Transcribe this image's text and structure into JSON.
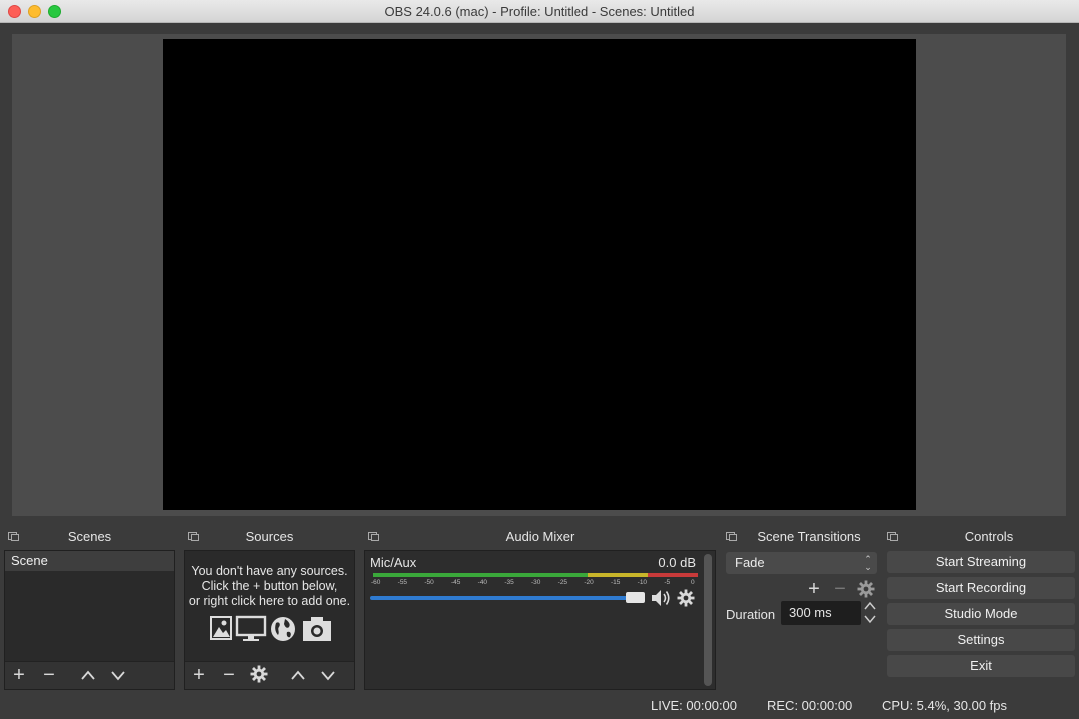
{
  "window": {
    "title": "OBS 24.0.6 (mac) - Profile: Untitled - Scenes: Untitled"
  },
  "scenes": {
    "title": "Scenes",
    "items": [
      "Scene"
    ]
  },
  "sources": {
    "title": "Sources",
    "empty_line1": "You don't have any sources.",
    "empty_line2": "Click the + button below,",
    "empty_line3": "or right click here to add one."
  },
  "audio_mixer": {
    "title": "Audio Mixer",
    "channel_name": "Mic/Aux",
    "channel_db": "0.0 dB",
    "volume_fraction": 1.0,
    "ticks": [
      "-60",
      "-55",
      "-50",
      "-45",
      "-40",
      "-35",
      "-30",
      "-25",
      "-20",
      "-15",
      "-10",
      "-5",
      "0"
    ]
  },
  "scene_transitions": {
    "title": "Scene Transitions",
    "selected": "Fade",
    "duration_label": "Duration",
    "duration_value": "300 ms"
  },
  "controls": {
    "title": "Controls",
    "start_streaming": "Start Streaming",
    "start_recording": "Start Recording",
    "studio_mode": "Studio Mode",
    "settings": "Settings",
    "exit": "Exit"
  },
  "status_bar": {
    "live": "LIVE: 00:00:00",
    "rec": "REC: 00:00:00",
    "cpu": "CPU: 5.4%, 30.00 fps"
  },
  "colors": {
    "meter_green": "#3aa83a",
    "meter_yellow": "#c8b52a",
    "meter_red": "#c83a3a",
    "slider_blue": "#2f7bd1"
  }
}
